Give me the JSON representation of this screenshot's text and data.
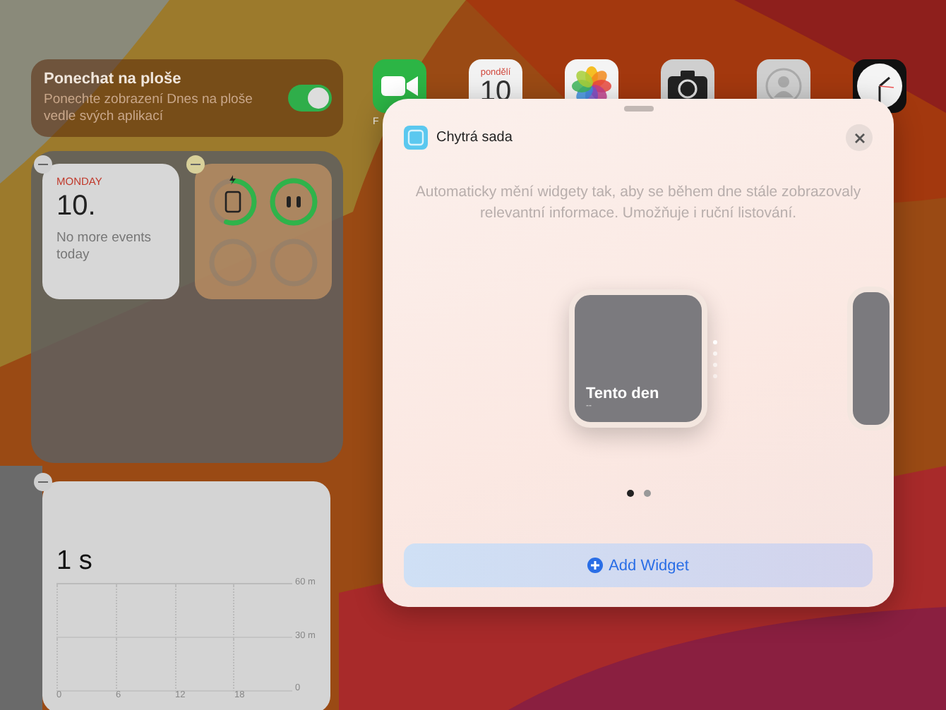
{
  "today_view": {
    "keep_on_screen": {
      "title": "Ponechat na ploše",
      "description": "Ponechte zobrazení Dnes na ploše vedle svých aplikací",
      "on": true
    },
    "calendar_widget": {
      "weekday": "MONDAY",
      "day": "10.",
      "events": "No more events today"
    },
    "battery_widget": {
      "items": [
        {
          "kind": "tablet",
          "charging": true
        },
        {
          "kind": "earbuds",
          "charging": false
        },
        {
          "kind": "empty",
          "charging": false
        },
        {
          "kind": "empty",
          "charging": false
        }
      ]
    },
    "screen_time_widget": {
      "total": "1 s",
      "y_labels": [
        "60 m",
        "30 m",
        "0"
      ],
      "x_labels": [
        "0",
        "6",
        "12",
        "18"
      ]
    }
  },
  "home_apps": [
    {
      "kind": "facetime",
      "label": "F"
    },
    {
      "kind": "calendar",
      "weekday": "pondělí",
      "day": "10"
    },
    {
      "kind": "photos"
    },
    {
      "kind": "camera"
    },
    {
      "kind": "contacts"
    },
    {
      "kind": "clock"
    }
  ],
  "sheet": {
    "title": "Chytrá sada",
    "description": "Automaticky mění widgety tak, aby se během dne stále zobrazovaly relevantní informace. Umožňuje i ruční listování.",
    "preview_title": "Tento den",
    "preview_subtitle": "--",
    "pages": [
      {
        "selected": true
      },
      {
        "selected": false
      }
    ],
    "add_button": "Add Widget"
  }
}
